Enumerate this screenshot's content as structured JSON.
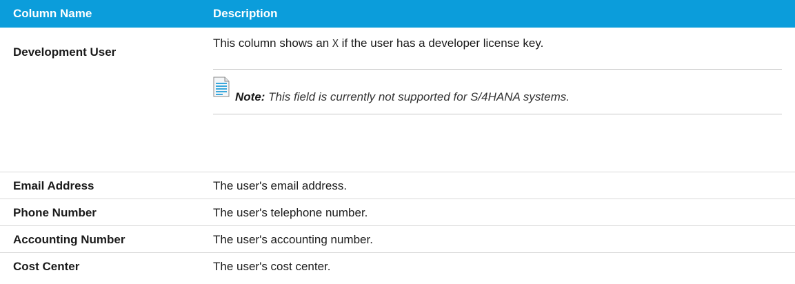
{
  "table": {
    "headers": {
      "column_name": "Column Name",
      "description": "Description"
    },
    "rows": [
      {
        "name": "Development User",
        "description_before": "This column shows an ",
        "description_code": "X",
        "description_after": " if the user has a developer license key.",
        "note": {
          "icon": "note-document-icon",
          "label": "Note:",
          "text": " This field is currently not supported for S/4HANA systems."
        }
      },
      {
        "name": "Email Address",
        "description": "The user's email address."
      },
      {
        "name": "Phone Number",
        "description": "The user's telephone number."
      },
      {
        "name": "Accounting Number",
        "description": "The user's accounting number."
      },
      {
        "name": "Cost Center",
        "description": "The user's cost center."
      }
    ]
  },
  "colors": {
    "header_bg": "#0b9ddb",
    "header_text": "#ffffff",
    "note_icon_line": "#3aa8dc"
  }
}
